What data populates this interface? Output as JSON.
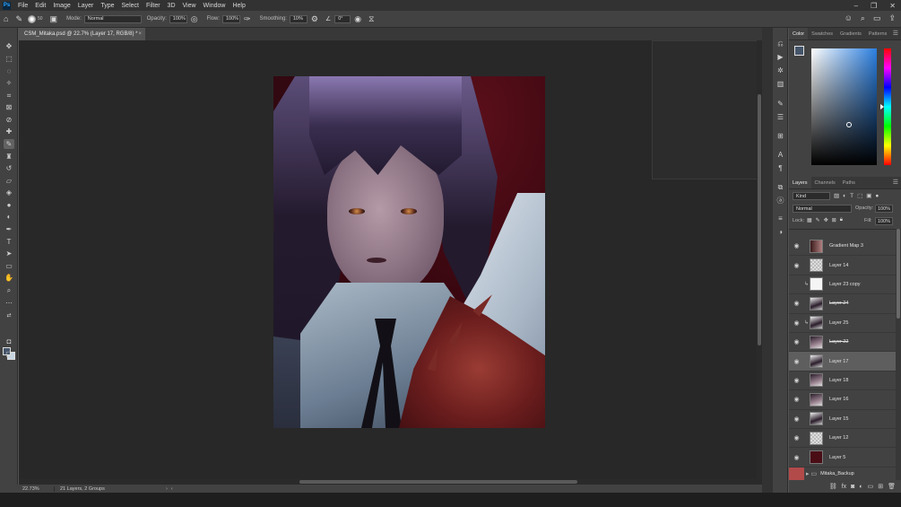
{
  "app": {
    "logo": "Ps",
    "menu": [
      "File",
      "Edit",
      "Image",
      "Layer",
      "Type",
      "Select",
      "Filter",
      "3D",
      "View",
      "Window",
      "Help"
    ],
    "window_controls": [
      "minimize-icon",
      "restore-icon",
      "close-icon"
    ]
  },
  "options": {
    "brush_size": "50",
    "mode_label": "Mode:",
    "mode_value": "Normal",
    "opacity_label": "Opacity:",
    "opacity_value": "100%",
    "flow_label": "Flow:",
    "flow_value": "100%",
    "smoothing_label": "Smoothing:",
    "smoothing_value": "10%",
    "angle_value": "0°"
  },
  "document": {
    "tab_title": "CSM_Mitaka.psd @ 22.7% (Layer 17, RGB/8) *",
    "tab_close": "×"
  },
  "status": {
    "zoom": "22.73%",
    "info": "21 Layers, 2 Groups",
    "arrow": "›",
    "arrow2": "‹"
  },
  "color_panel": {
    "tabs": [
      "Color",
      "Swatches",
      "Gradients",
      "Patterns"
    ],
    "foreground": "#45556a",
    "background": "#c7d6e3"
  },
  "layers_panel": {
    "tabs": [
      "Layers",
      "Channels",
      "Paths"
    ],
    "filter_kind": "Kind",
    "blend_mode": "Normal",
    "opacity_label": "Opacity:",
    "opacity_value": "100%",
    "lock_label": "Lock:",
    "fill_label": "Fill:",
    "fill_value": "100%",
    "layers": [
      {
        "name": "Gradient Map 3",
        "visible": true,
        "thumb": "grad",
        "clipped": false,
        "struck": false,
        "selected": false
      },
      {
        "name": "Layer 14",
        "visible": true,
        "thumb": "checker",
        "clipped": false,
        "struck": false,
        "selected": false
      },
      {
        "name": "Layer 23 copy",
        "visible": false,
        "thumb": "white",
        "clipped": true,
        "struck": false,
        "selected": false
      },
      {
        "name": "Layer 24",
        "visible": true,
        "thumb": "art2",
        "clipped": false,
        "struck": true,
        "selected": false
      },
      {
        "name": "Layer 25",
        "visible": true,
        "thumb": "art2",
        "clipped": true,
        "struck": false,
        "selected": false
      },
      {
        "name": "Layer 22",
        "visible": true,
        "thumb": "art",
        "clipped": false,
        "struck": true,
        "selected": false
      },
      {
        "name": "Layer 17",
        "visible": true,
        "thumb": "art2",
        "clipped": false,
        "struck": false,
        "selected": true
      },
      {
        "name": "Layer 18",
        "visible": true,
        "thumb": "art",
        "clipped": false,
        "struck": false,
        "selected": false
      },
      {
        "name": "Layer 16",
        "visible": true,
        "thumb": "art",
        "clipped": false,
        "struck": false,
        "selected": false
      },
      {
        "name": "Layer 15",
        "visible": true,
        "thumb": "art2",
        "clipped": false,
        "struck": false,
        "selected": false
      },
      {
        "name": "Layer 12",
        "visible": true,
        "thumb": "checker",
        "clipped": false,
        "struck": false,
        "selected": false
      },
      {
        "name": "Layer 5",
        "visible": true,
        "thumb": "dark",
        "clipped": false,
        "struck": false,
        "selected": false
      }
    ],
    "group_name": "Mitaka_Backup"
  }
}
